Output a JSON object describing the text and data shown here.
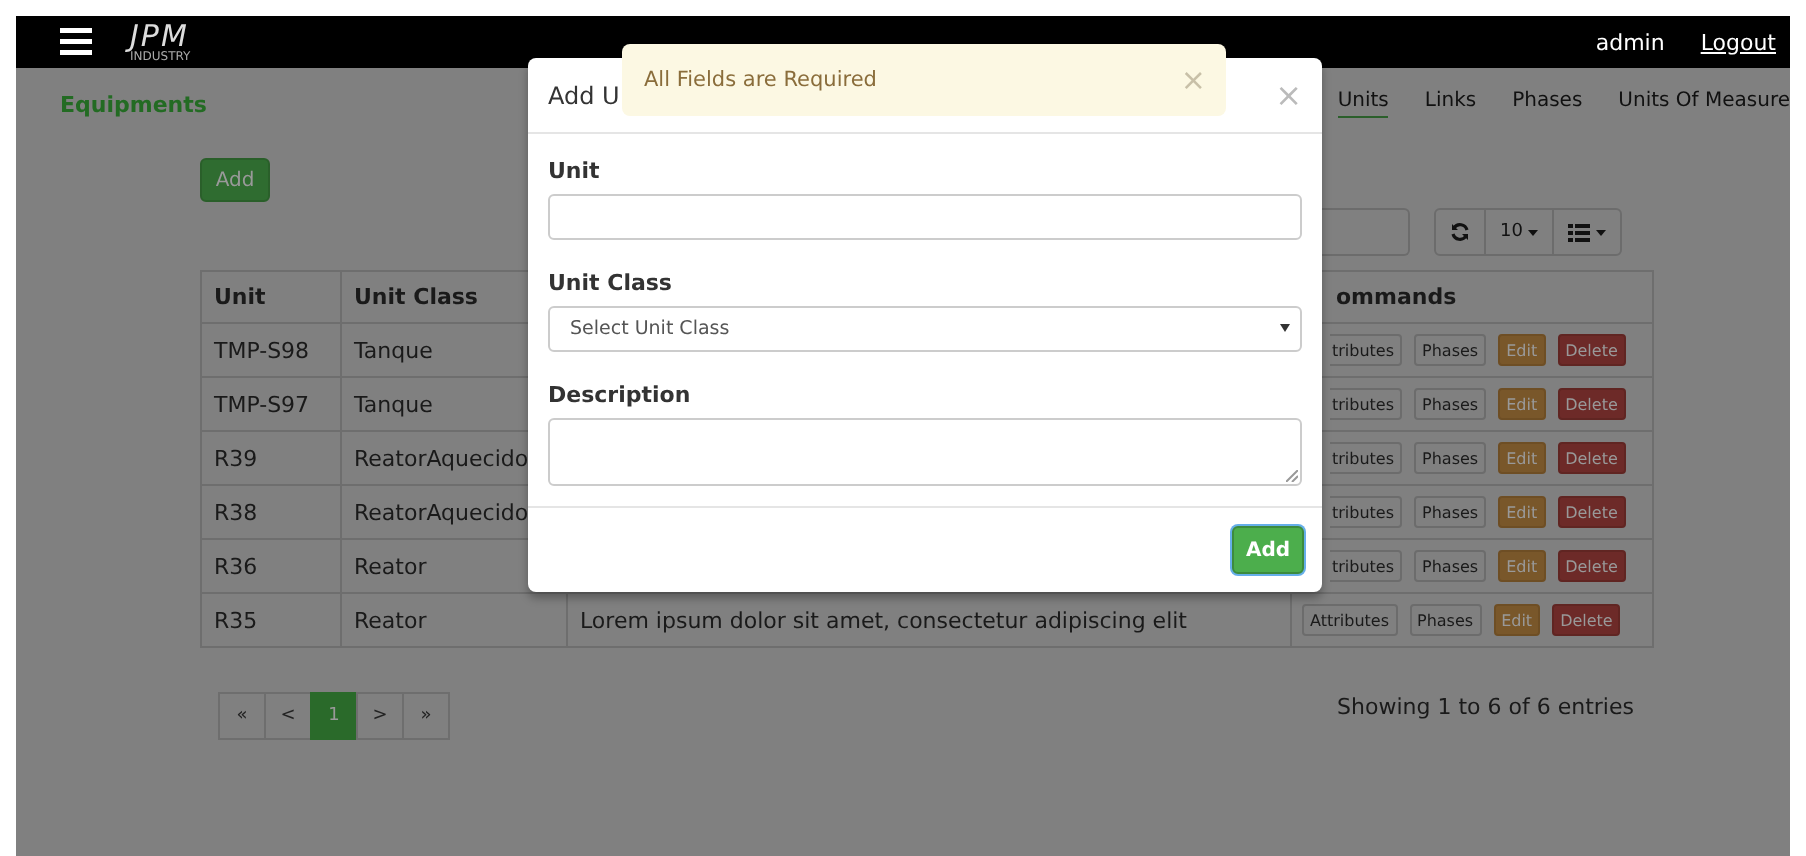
{
  "navbar": {
    "logo": "JPM",
    "logo_subtitle": "INDUSTRY",
    "user": "admin",
    "logout": "Logout"
  },
  "page": {
    "heading": "Equipments",
    "tabs": [
      {
        "label": "Units",
        "selected": true
      },
      {
        "label": "Links",
        "selected": false
      },
      {
        "label": "Phases",
        "selected": false
      },
      {
        "label": "Units Of Measure",
        "selected": false
      }
    ],
    "add_button": "Add",
    "page_size": "10"
  },
  "table": {
    "columns": [
      "Unit",
      "Unit Class",
      "ommands"
    ],
    "rows": [
      {
        "unit": "TMP-S98",
        "unit_class": "Tanque",
        "commands": [
          {
            "label": "tributes",
            "kind": "clipped"
          },
          {
            "label": "Phases",
            "kind": "default"
          },
          {
            "label": "Edit",
            "kind": "warning"
          },
          {
            "label": "Delete",
            "kind": "danger"
          }
        ]
      },
      {
        "unit": "TMP-S97",
        "unit_class": "Tanque",
        "commands": [
          {
            "label": "tributes",
            "kind": "clipped"
          },
          {
            "label": "Phases",
            "kind": "default"
          },
          {
            "label": "Edit",
            "kind": "warning"
          },
          {
            "label": "Delete",
            "kind": "danger"
          }
        ]
      },
      {
        "unit": "R39",
        "unit_class": "ReatorAquecido",
        "commands": [
          {
            "label": "tributes",
            "kind": "clipped"
          },
          {
            "label": "Phases",
            "kind": "default"
          },
          {
            "label": "Edit",
            "kind": "warning"
          },
          {
            "label": "Delete",
            "kind": "danger"
          }
        ]
      },
      {
        "unit": "R38",
        "unit_class": "ReatorAquecido",
        "commands": [
          {
            "label": "tributes",
            "kind": "clipped"
          },
          {
            "label": "Phases",
            "kind": "default"
          },
          {
            "label": "Edit",
            "kind": "warning"
          },
          {
            "label": "Delete",
            "kind": "danger"
          }
        ]
      },
      {
        "unit": "R36",
        "unit_class": "Reator",
        "commands": [
          {
            "label": "tributes",
            "kind": "clipped"
          },
          {
            "label": "Phases",
            "kind": "default"
          },
          {
            "label": "Edit",
            "kind": "warning"
          },
          {
            "label": "Delete",
            "kind": "danger"
          }
        ]
      },
      {
        "unit": "R35",
        "unit_class": "Reator",
        "description": "Lorem ipsum dolor sit amet, consectetur adipiscing elit",
        "commands": [
          {
            "label": "Attributes",
            "kind": "default"
          },
          {
            "label": "Phases",
            "kind": "default"
          },
          {
            "label": "Edit",
            "kind": "warning"
          },
          {
            "label": "Delete",
            "kind": "danger"
          }
        ]
      }
    ]
  },
  "pagination": {
    "items": [
      {
        "label": "«",
        "selected": false
      },
      {
        "label": "<",
        "selected": false
      },
      {
        "label": "1",
        "selected": true
      },
      {
        "label": ">",
        "selected": false
      },
      {
        "label": "»",
        "selected": false
      }
    ],
    "info": "Showing 1 to 6 of 6 entries"
  },
  "modal": {
    "title": "Add U",
    "close": "×",
    "fields": [
      {
        "label": "Unit",
        "kind": "text"
      },
      {
        "label": "Unit Class",
        "kind": "select",
        "placeholder": "Select Unit Class"
      },
      {
        "label": "Description",
        "kind": "textarea"
      }
    ],
    "submit": "Add"
  },
  "alert": {
    "message": "All Fields are Required",
    "close": "×"
  }
}
